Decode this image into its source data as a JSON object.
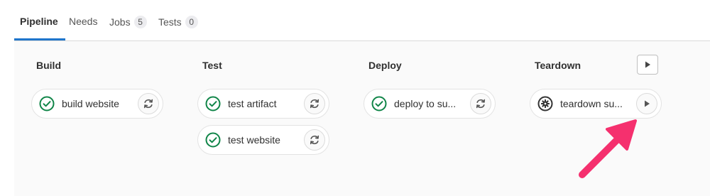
{
  "tabs": [
    {
      "label": "Pipeline"
    },
    {
      "label": "Needs"
    },
    {
      "label": "Jobs",
      "count": "5"
    },
    {
      "label": "Tests",
      "count": "0"
    }
  ],
  "stages": [
    {
      "title": "Build",
      "jobs": [
        {
          "name": "build website",
          "status": "success",
          "action": "retry"
        }
      ]
    },
    {
      "title": "Test",
      "jobs": [
        {
          "name": "test artifact",
          "status": "success",
          "action": "retry"
        },
        {
          "name": "test website",
          "status": "success",
          "action": "retry"
        }
      ]
    },
    {
      "title": "Deploy",
      "jobs": [
        {
          "name": "deploy to su...",
          "status": "success",
          "action": "retry"
        }
      ]
    },
    {
      "title": "Teardown",
      "jobs": [
        {
          "name": "teardown su...",
          "status": "manual",
          "action": "play"
        }
      ]
    }
  ],
  "colors": {
    "success": "#108548",
    "accent": "#1f75cb",
    "arrow": "#f5306e"
  },
  "icons": {
    "success": "check-circle-icon",
    "manual": "gear-icon",
    "retry": "retry-icon",
    "play": "play-icon"
  }
}
